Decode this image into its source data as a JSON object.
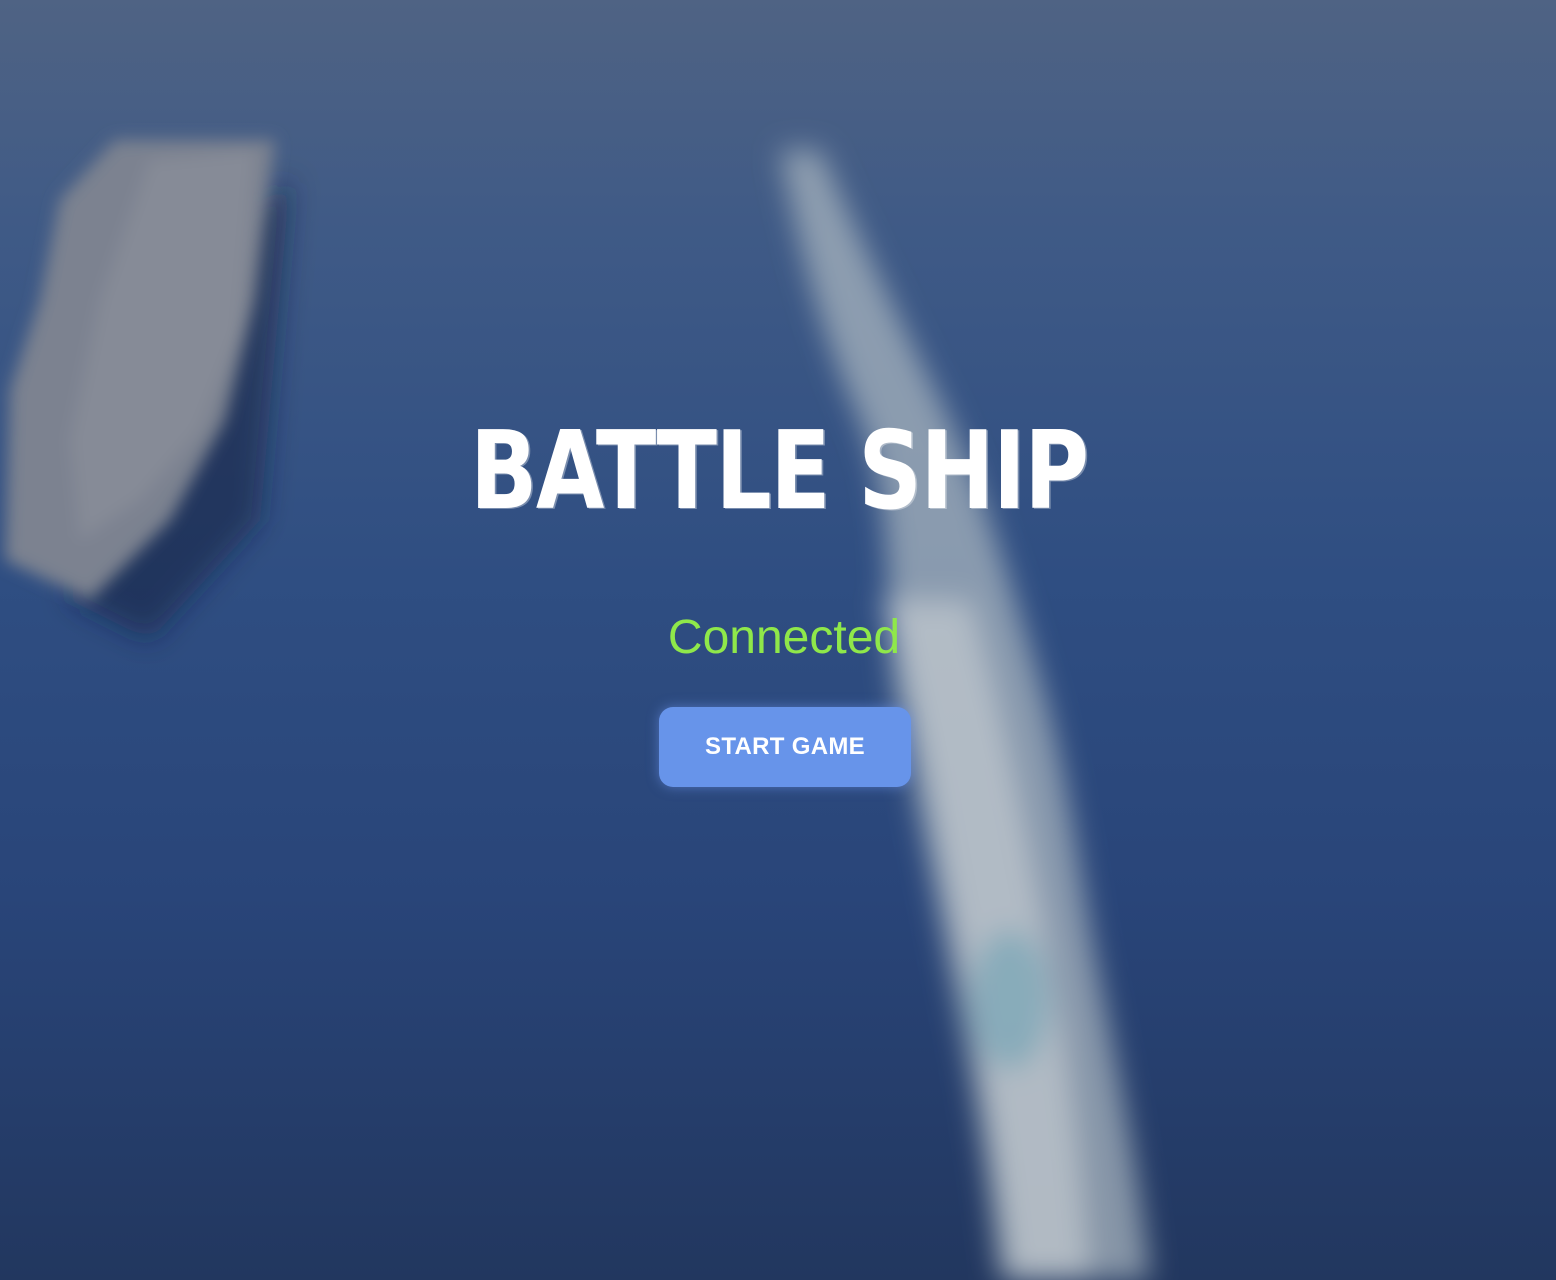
{
  "game": {
    "title": "BATTLE SHIP",
    "status": "Connected",
    "start_button_label": "START GAME"
  },
  "colors": {
    "status_connected": "#8fe84a",
    "button_bg": "#6794ea",
    "button_text": "#ffffff",
    "title_text": "#ffffff"
  },
  "background": {
    "scene": "blurred aerial view of aircraft carrier on ocean with wake"
  }
}
